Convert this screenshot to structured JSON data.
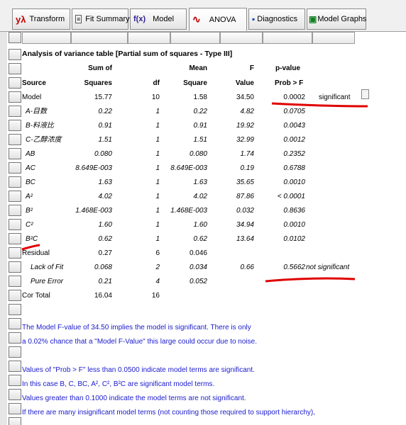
{
  "toolbar": {
    "tabs": [
      {
        "label": "Transform",
        "icon": "yλ"
      },
      {
        "label": "Fit Summary",
        "icon": "≡"
      },
      {
        "label": "Model",
        "icon": "f(x)"
      },
      {
        "label": "ANOVA",
        "icon": "∿"
      },
      {
        "label": "Diagnostics",
        "icon": "▪"
      },
      {
        "label": "Model Graphs",
        "icon": "▣"
      }
    ]
  },
  "colors": {
    "annotation_red": "#e00000",
    "note_blue": "#1a1acc"
  },
  "anova": {
    "title": "Analysis of variance table [Partial sum of squares - Type III]",
    "header1": {
      "sum": "Sum of",
      "mean": "Mean",
      "f": "F",
      "p": "p-value"
    },
    "header2": {
      "source": "Source",
      "sum": "Squares",
      "df": "df",
      "mean": "Square",
      "f": "Value",
      "p": "Prob > F"
    },
    "rows": [
      {
        "source": "Model",
        "ss": "15.77",
        "df": "10",
        "ms": "1.58",
        "f": "34.50",
        "p": "0.0002",
        "sig": "significant"
      },
      {
        "source": "A-目数",
        "ss": "0.22",
        "df": "1",
        "ms": "0.22",
        "f": "4.82",
        "p": "0.0705",
        "sig": ""
      },
      {
        "source": "B-料液比",
        "ss": "0.91",
        "df": "1",
        "ms": "0.91",
        "f": "19.92",
        "p": "0.0043",
        "sig": ""
      },
      {
        "source": "C-乙醇浓度",
        "ss": "1.51",
        "df": "1",
        "ms": "1.51",
        "f": "32.99",
        "p": "0.0012",
        "sig": ""
      },
      {
        "source": "AB",
        "ss": "0.080",
        "df": "1",
        "ms": "0.080",
        "f": "1.74",
        "p": "0.2352",
        "sig": ""
      },
      {
        "source": "AC",
        "ss": "8.649E-003",
        "df": "1",
        "ms": "8.649E-003",
        "f": "0.19",
        "p": "0.6788",
        "sig": ""
      },
      {
        "source": "BC",
        "ss": "1.63",
        "df": "1",
        "ms": "1.63",
        "f": "35.65",
        "p": "0.0010",
        "sig": ""
      },
      {
        "source": "A²",
        "ss": "4.02",
        "df": "1",
        "ms": "4.02",
        "f": "87.86",
        "p": "< 0.0001",
        "sig": ""
      },
      {
        "source": "B²",
        "ss": "1.468E-003",
        "df": "1",
        "ms": "1.468E-003",
        "f": "0.032",
        "p": "0.8636",
        "sig": ""
      },
      {
        "source": "C²",
        "ss": "1.60",
        "df": "1",
        "ms": "1.60",
        "f": "34.94",
        "p": "0.0010",
        "sig": ""
      },
      {
        "source": "B²C",
        "ss": "0.62",
        "df": "1",
        "ms": "0.62",
        "f": "13.64",
        "p": "0.0102",
        "sig": ""
      },
      {
        "source": "Residual",
        "ss": "0.27",
        "df": "6",
        "ms": "0.046",
        "f": "",
        "p": "",
        "sig": ""
      },
      {
        "source": "Lack of Fit",
        "ss": "0.068",
        "df": "2",
        "ms": "0.034",
        "f": "0.66",
        "p": "0.5662",
        "sig": "not significant"
      },
      {
        "source": "Pure Error",
        "ss": "0.21",
        "df": "4",
        "ms": "0.052",
        "f": "",
        "p": "",
        "sig": ""
      },
      {
        "source": "Cor Total",
        "ss": "16.04",
        "df": "16",
        "ms": "",
        "f": "",
        "p": "",
        "sig": ""
      }
    ]
  },
  "notes": [
    "The Model F-value of 34.50 implies the model is significant.  There is only",
    "a 0.02% chance that a \"Model F-Value\" this large could occur due to noise.",
    "",
    "Values of \"Prob > F\" less than 0.0500 indicate model terms are significant.",
    "In this case B, C, BC, A², C², B²C are significant model terms.",
    "Values greater than 0.1000 indicate the model terms are not significant.",
    "If there are many insignificant model terms (not counting those required to support hierarchy),"
  ]
}
